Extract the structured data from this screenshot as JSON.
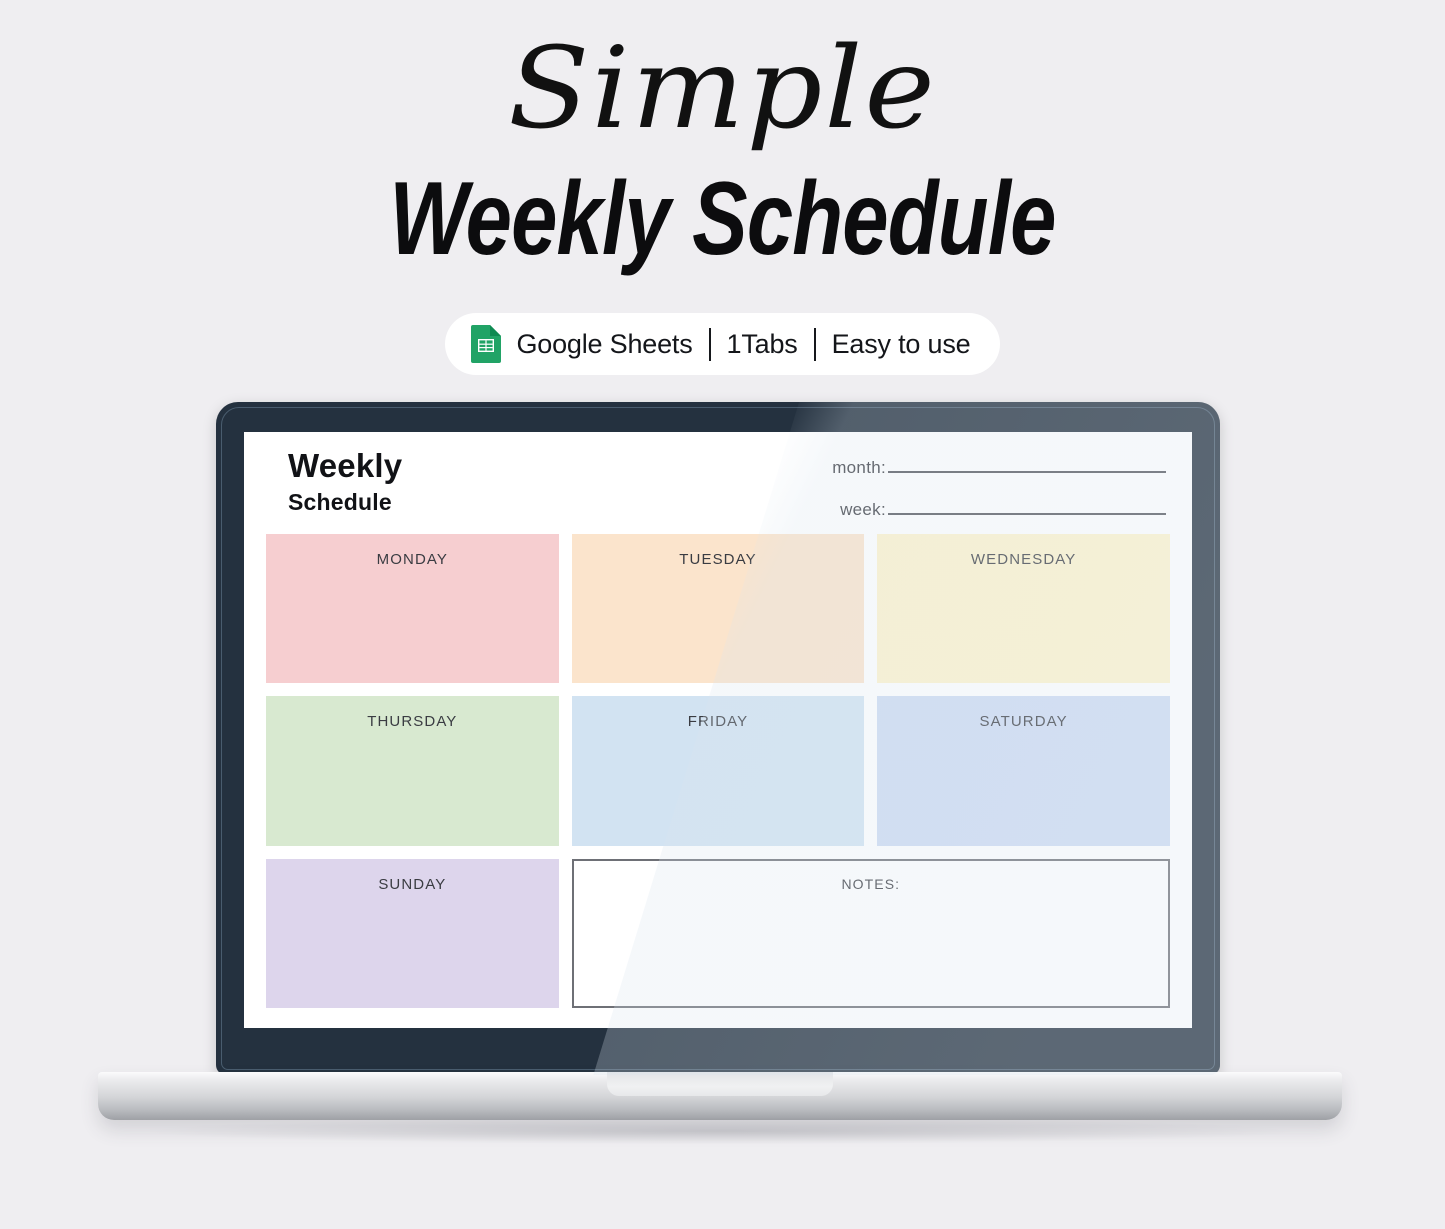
{
  "hero": {
    "script_word": "Simple",
    "main_title": "Weekly Schedule"
  },
  "badge": {
    "icon": "google-sheets-icon",
    "platform": "Google Sheets",
    "separator": "|",
    "tabs": "1Tabs",
    "ease": "Easy to use"
  },
  "sheet": {
    "title_line1": "Weekly",
    "title_line2": "Schedule",
    "fields": [
      {
        "label": "month:",
        "value": ""
      },
      {
        "label": "week:",
        "value": ""
      }
    ],
    "days": [
      {
        "label": "MONDAY",
        "color": "#f6ced0"
      },
      {
        "label": "TUESDAY",
        "color": "#fbe4cc"
      },
      {
        "label": "WEDNESDAY",
        "color": "#fdf3cc"
      },
      {
        "label": "THURSDAY",
        "color": "#d8e9d0"
      },
      {
        "label": "FRIDAY",
        "color": "#d2e3f2"
      },
      {
        "label": "SATURDAY",
        "color": "#cddbf2"
      },
      {
        "label": "SUNDAY",
        "color": "#ddd5ec"
      }
    ],
    "notes_label": "NOTES:"
  },
  "colors": {
    "background": "#efeef1",
    "laptop_bezel": "#24313f",
    "laptop_base": "#d4d5d8",
    "sheets_green": "#21a366",
    "text_dark": "#111216"
  }
}
